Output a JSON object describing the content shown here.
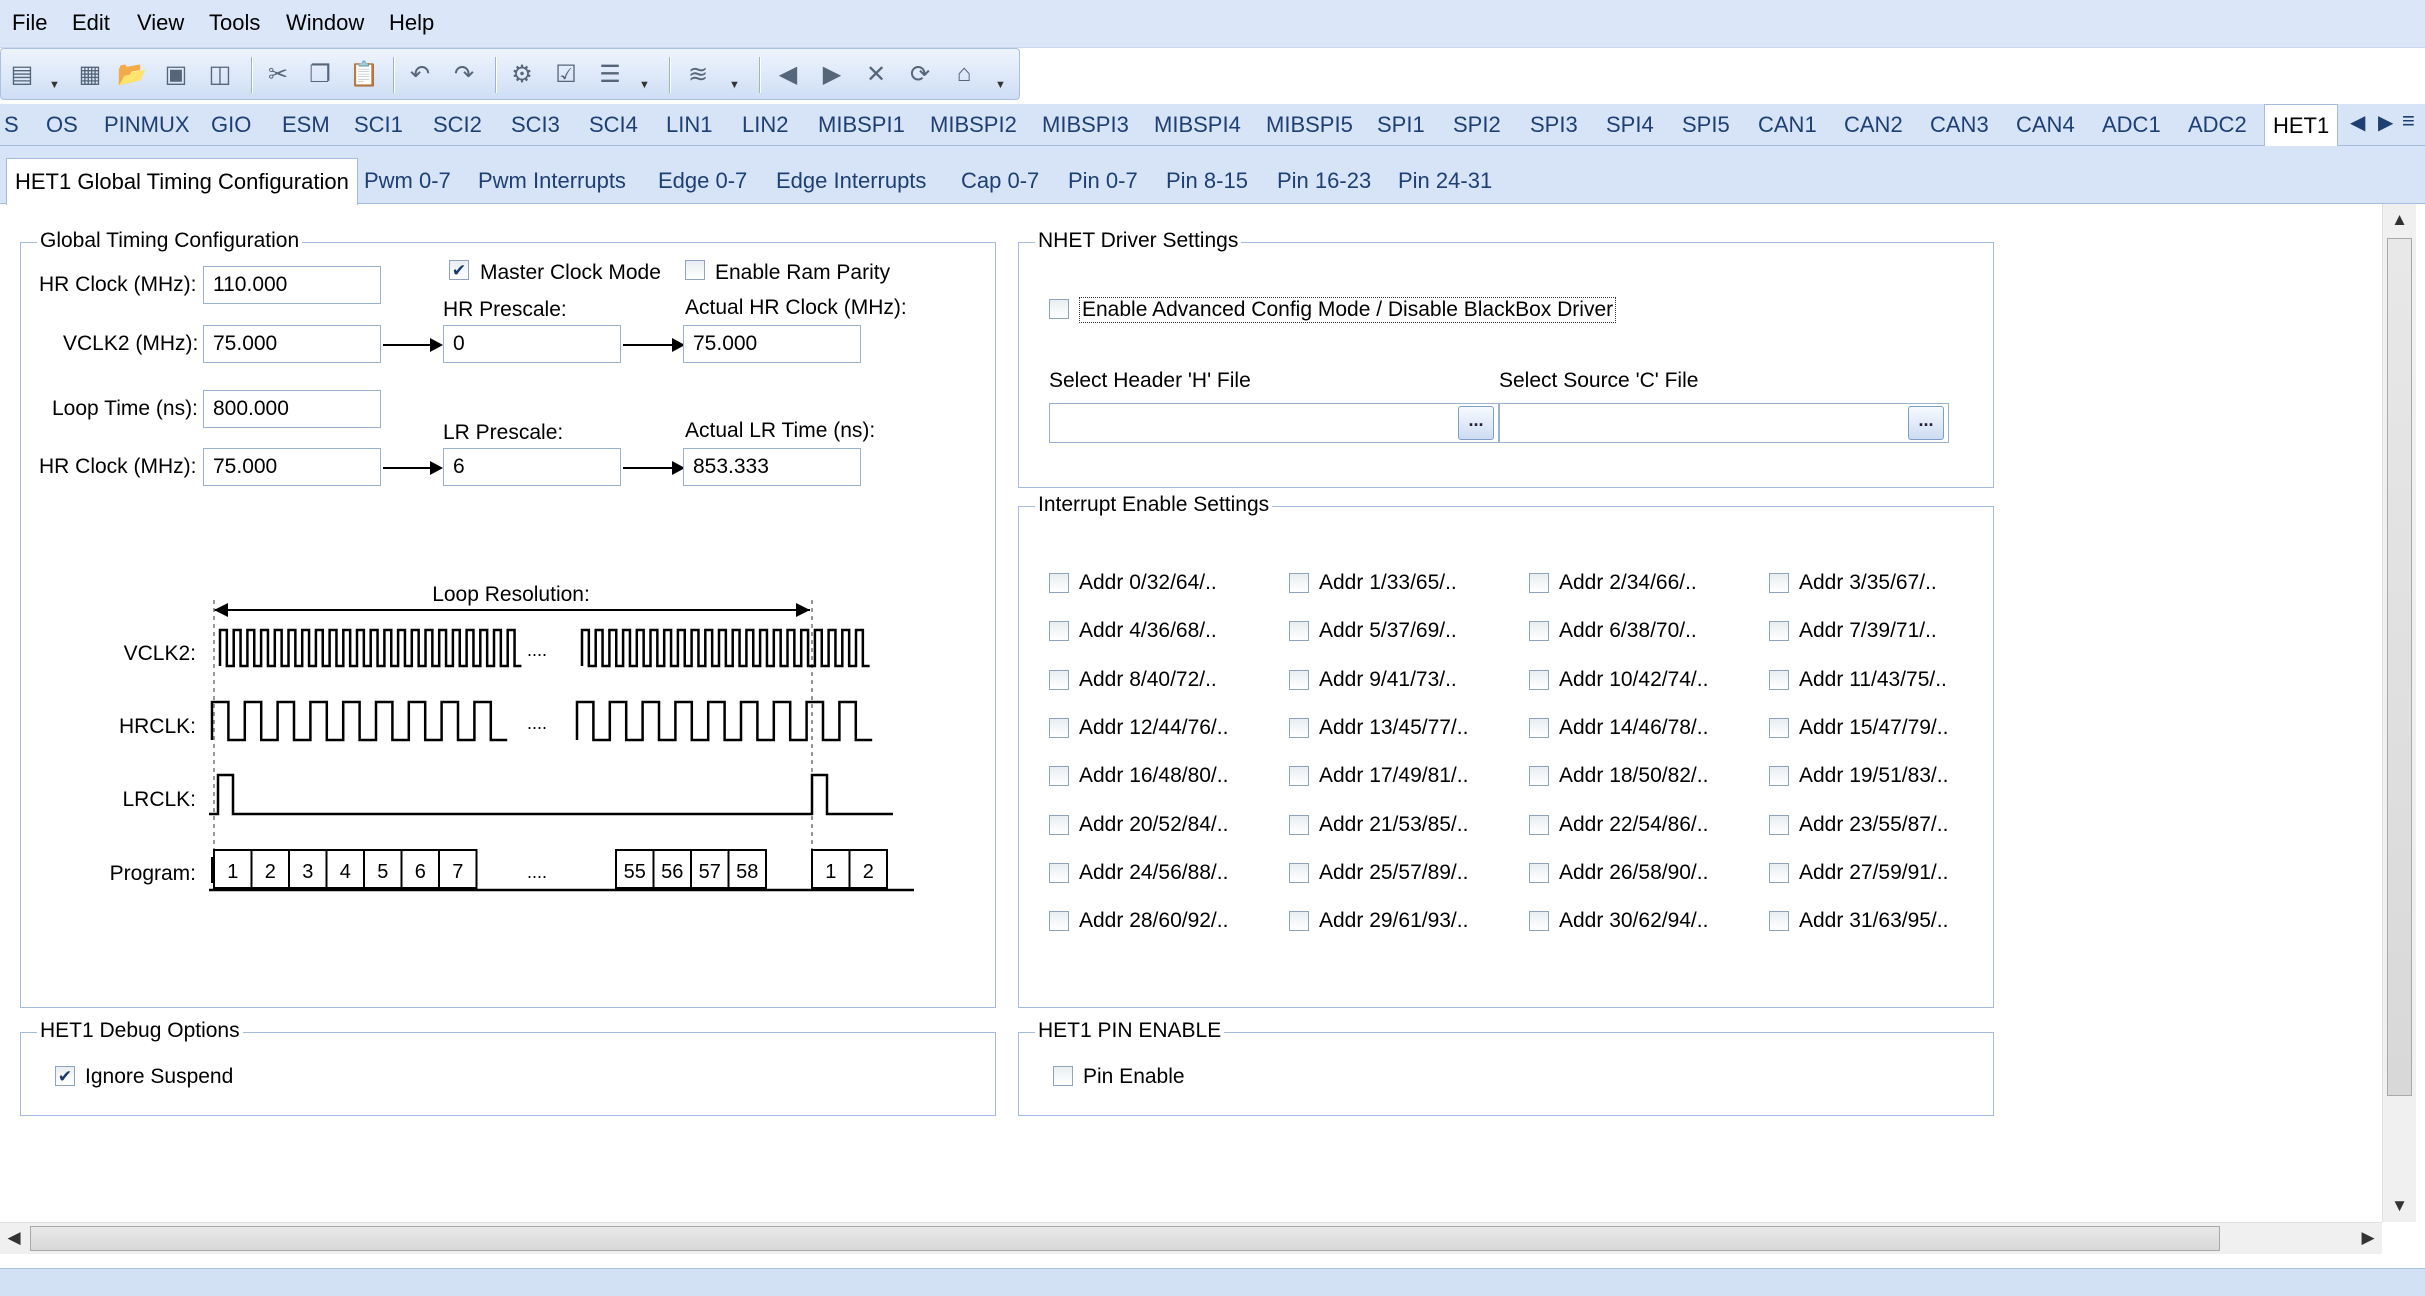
{
  "menu": {
    "items": [
      "File",
      "Edit",
      "View",
      "Tools",
      "Window",
      "Help"
    ]
  },
  "module_tabs": {
    "items": [
      "S",
      "OS",
      "PINMUX",
      "GIO",
      "ESM",
      "SCI1",
      "SCI2",
      "SCI3",
      "SCI4",
      "LIN1",
      "LIN2",
      "MIBSPI1",
      "MIBSPI2",
      "MIBSPI3",
      "MIBSPI4",
      "MIBSPI5",
      "SPI1",
      "SPI2",
      "SPI3",
      "SPI4",
      "SPI5",
      "CAN1",
      "CAN2",
      "CAN3",
      "CAN4",
      "ADC1",
      "ADC2",
      "HET1"
    ],
    "active": "HET1"
  },
  "sub_tabs": {
    "items": [
      "HET1 Global Timing Configuration",
      "Pwm 0-7",
      "Pwm Interrupts",
      "Edge 0-7",
      "Edge Interrupts",
      "Cap 0-7",
      "Pin 0-7",
      "Pin 8-15",
      "Pin 16-23",
      "Pin 24-31"
    ],
    "active": "HET1 Global Timing Configuration"
  },
  "global_timing": {
    "title": "Global Timing Configuration",
    "hr_clock_label": "HR Clock (MHz):",
    "hr_clock_value": "110.000",
    "master_clock_label": "Master Clock Mode",
    "master_clock_checked": true,
    "ram_parity_label": "Enable Ram Parity",
    "ram_parity_checked": false,
    "vclk2_label": "VCLK2 (MHz):",
    "vclk2_value": "75.000",
    "hr_prescale_label": "HR Prescale:",
    "hr_prescale_value": "0",
    "actual_hr_label": "Actual HR Clock (MHz):",
    "actual_hr_value": "75.000",
    "loop_time_label": "Loop Time (ns):",
    "loop_time_value": "800.000",
    "lr_prescale_label": "LR Prescale:",
    "lr_prescale_value": "6",
    "actual_lr_label": "Actual LR Time (ns):",
    "actual_lr_value": "853.333",
    "hr_clock2_label": "HR Clock (MHz):",
    "hr_clock2_value": "75.000"
  },
  "timing_diagram": {
    "loop_resolution": "Loop Resolution:",
    "rows": [
      "VCLK2:",
      "HRCLK:",
      "LRCLK:",
      "Program:"
    ],
    "ellipsis": "....",
    "program_slots_a": [
      "1",
      "2",
      "3",
      "4",
      "5",
      "6",
      "7"
    ],
    "program_slots_b": [
      "55",
      "56",
      "57",
      "58"
    ],
    "program_slots_c": [
      "1",
      "2"
    ]
  },
  "nhet_driver": {
    "title": "NHET Driver Settings",
    "advanced_label": "Enable Advanced Config Mode / Disable BlackBox Driver",
    "advanced_checked": false,
    "header_label": "Select Header 'H' File",
    "header_value": "",
    "source_label": "Select Source 'C' File",
    "source_value": "",
    "browse_label": "..."
  },
  "interrupt_enable": {
    "title": "Interrupt Enable Settings",
    "items": [
      "Addr 0/32/64/..",
      "Addr 1/33/65/..",
      "Addr 2/34/66/..",
      "Addr 3/35/67/..",
      "Addr 4/36/68/..",
      "Addr 5/37/69/..",
      "Addr 6/38/70/..",
      "Addr 7/39/71/..",
      "Addr 8/40/72/..",
      "Addr 9/41/73/..",
      "Addr 10/42/74/..",
      "Addr 11/43/75/..",
      "Addr 12/44/76/..",
      "Addr 13/45/77/..",
      "Addr 14/46/78/..",
      "Addr 15/47/79/..",
      "Addr 16/48/80/..",
      "Addr 17/49/81/..",
      "Addr 18/50/82/..",
      "Addr 19/51/83/..",
      "Addr 20/52/84/..",
      "Addr 21/53/85/..",
      "Addr 22/54/86/..",
      "Addr 23/55/87/..",
      "Addr 24/56/88/..",
      "Addr 25/57/89/..",
      "Addr 26/58/90/..",
      "Addr 27/59/91/..",
      "Addr 28/60/92/..",
      "Addr 29/61/93/..",
      "Addr 30/62/94/..",
      "Addr 31/63/95/.."
    ]
  },
  "debug_options": {
    "title": "HET1 Debug Options",
    "ignore_suspend_label": "Ignore Suspend",
    "ignore_suspend_checked": true
  },
  "pin_enable": {
    "title": "HET1 PIN ENABLE",
    "pin_enable_label": "Pin Enable",
    "pin_enable_checked": false
  },
  "icons": {
    "toolbar": [
      "new-project-icon",
      "properties-icon",
      "open-icon",
      "save-icon",
      "save-all-icon",
      "cut-icon",
      "copy-icon",
      "paste-icon",
      "undo-icon",
      "redo-icon",
      "generate-icon",
      "check-icon",
      "list-icon",
      "stack-icon",
      "back-icon",
      "forward-icon",
      "close-doc-icon",
      "refresh-icon",
      "home-icon"
    ],
    "tab_scroll": [
      "tab-scroll-left-icon",
      "tab-scroll-right-icon",
      "tab-list-icon"
    ]
  }
}
